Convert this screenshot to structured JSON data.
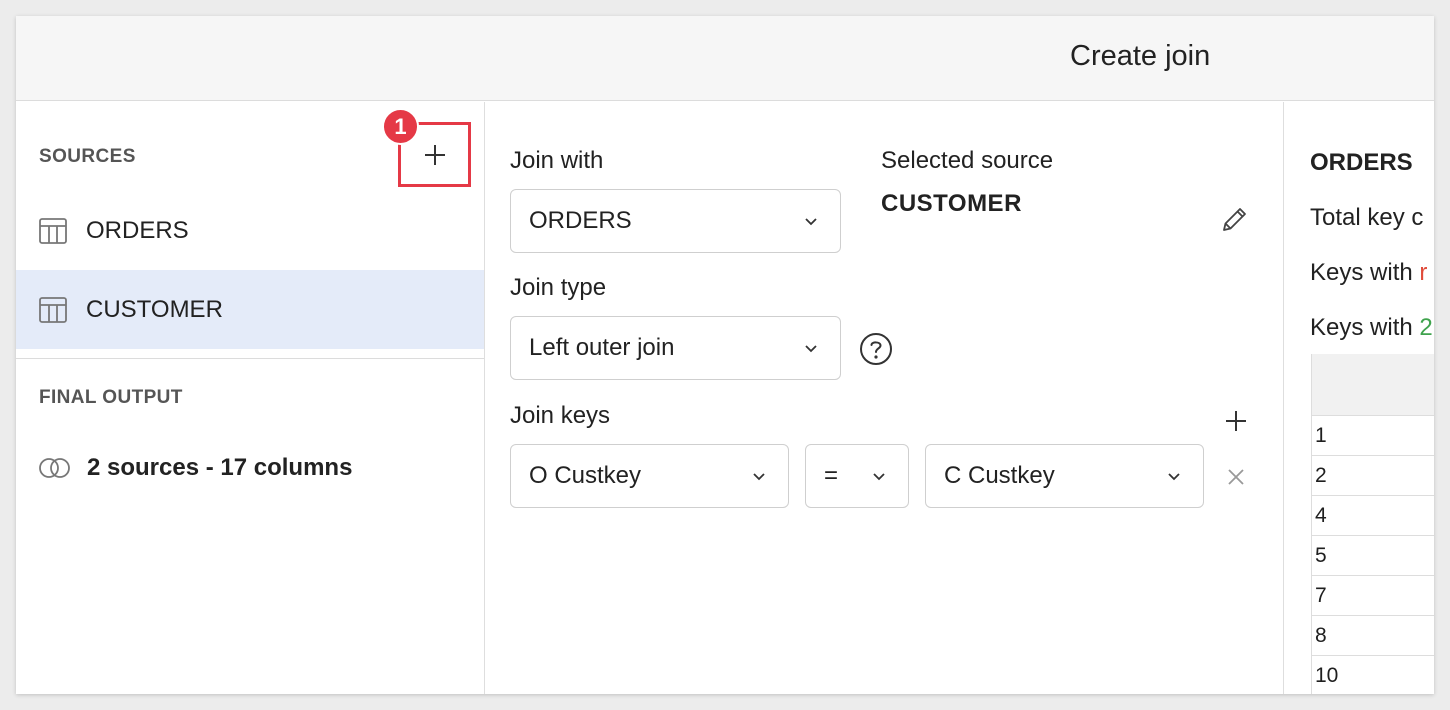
{
  "dialog": {
    "title": "Create join"
  },
  "sources": {
    "label": "SOURCES",
    "add_step_badge": "1",
    "items": [
      {
        "label": "ORDERS",
        "icon": "table-icon",
        "selected": false
      },
      {
        "label": "CUSTOMER",
        "icon": "table-icon",
        "selected": true
      }
    ]
  },
  "final_output": {
    "label": "FINAL OUTPUT",
    "summary": "2 sources - 17 columns",
    "icon": "venn-join-icon"
  },
  "join": {
    "join_with_label": "Join with",
    "join_with_value": "ORDERS",
    "selected_source_label": "Selected source",
    "selected_source_value": "CUSTOMER",
    "join_type_label": "Join type",
    "join_type_value": "Left outer join",
    "join_keys_label": "Join keys",
    "keys": [
      {
        "left": "O Custkey",
        "operator": "=",
        "right": "C Custkey"
      }
    ]
  },
  "preview": {
    "title": "ORDERS",
    "line1": "Total key c",
    "line2_prefix": "Keys with ",
    "line2_accent": "r",
    "line3_prefix": "Keys with ",
    "line3_accent": "2",
    "rows": [
      "1",
      "2",
      "4",
      "5",
      "7",
      "8",
      "10"
    ]
  },
  "colors": {
    "accent_red": "#e53946",
    "selected_bg": "#e4ebf9",
    "red_text": "#e04b3a",
    "green_text": "#3fa34d"
  }
}
